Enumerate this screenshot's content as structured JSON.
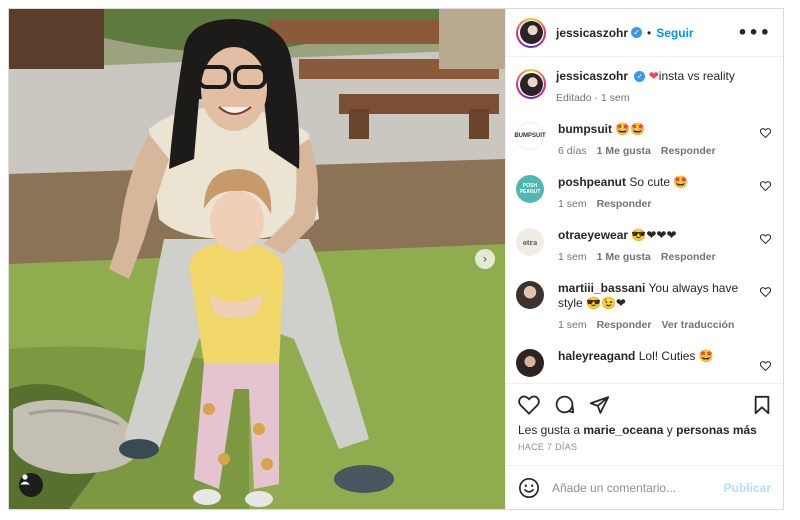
{
  "post": {
    "username": "jessicaszohr",
    "follow_label": "Seguir",
    "more_label": "•••",
    "caption_text": "insta vs reality",
    "caption_meta": "Editado · 1 sem",
    "next_icon": "chevron-right-icon",
    "tag_icon": "user-tag-icon"
  },
  "comments": [
    {
      "user": "bumpsuit",
      "text": "🤩🤩",
      "time": "6 días",
      "likes": "1 Me gusta",
      "reply": "Responder",
      "extra": "",
      "avatar_text": "BUMPSUIT",
      "avatar_color": "#ffffff"
    },
    {
      "user": "poshpeanut",
      "text": "So cute 🤩",
      "time": "1 sem",
      "likes": "",
      "reply": "Responder",
      "extra": "",
      "avatar_text": "POSH PEANUT",
      "avatar_color": "#4fb8b0"
    },
    {
      "user": "otraeyewear",
      "text": "😎❤❤❤",
      "time": "1 sem",
      "likes": "1 Me gusta",
      "reply": "Responder",
      "extra": "",
      "avatar_text": "otra",
      "avatar_color": "#f1ece6"
    },
    {
      "user": "martiii_bassani",
      "text": "You always have style 😎😉❤",
      "time": "1 sem",
      "likes": "",
      "reply": "Responder",
      "extra": "Ver traducción",
      "avatar_text": "",
      "avatar_color": "#8a7a70"
    },
    {
      "user": "haleyreagand",
      "text": "Lol! Cuties 🤩",
      "time": "",
      "likes": "",
      "reply": "",
      "extra": "",
      "avatar_text": "",
      "avatar_color": "#6b5a50"
    }
  ],
  "likes": {
    "prefix": "Les gusta a",
    "user": "marie_oceana",
    "joiner": "y",
    "rest": "personas más"
  },
  "time_ago": "HACE 7 DÍAS",
  "add_comment": {
    "placeholder": "Añade un comentario...",
    "post_label": "Publicar"
  },
  "colors": {
    "accent": "#0095f6",
    "verified": "#3897f0",
    "heart": "#ed4956",
    "muted": "#737373"
  }
}
